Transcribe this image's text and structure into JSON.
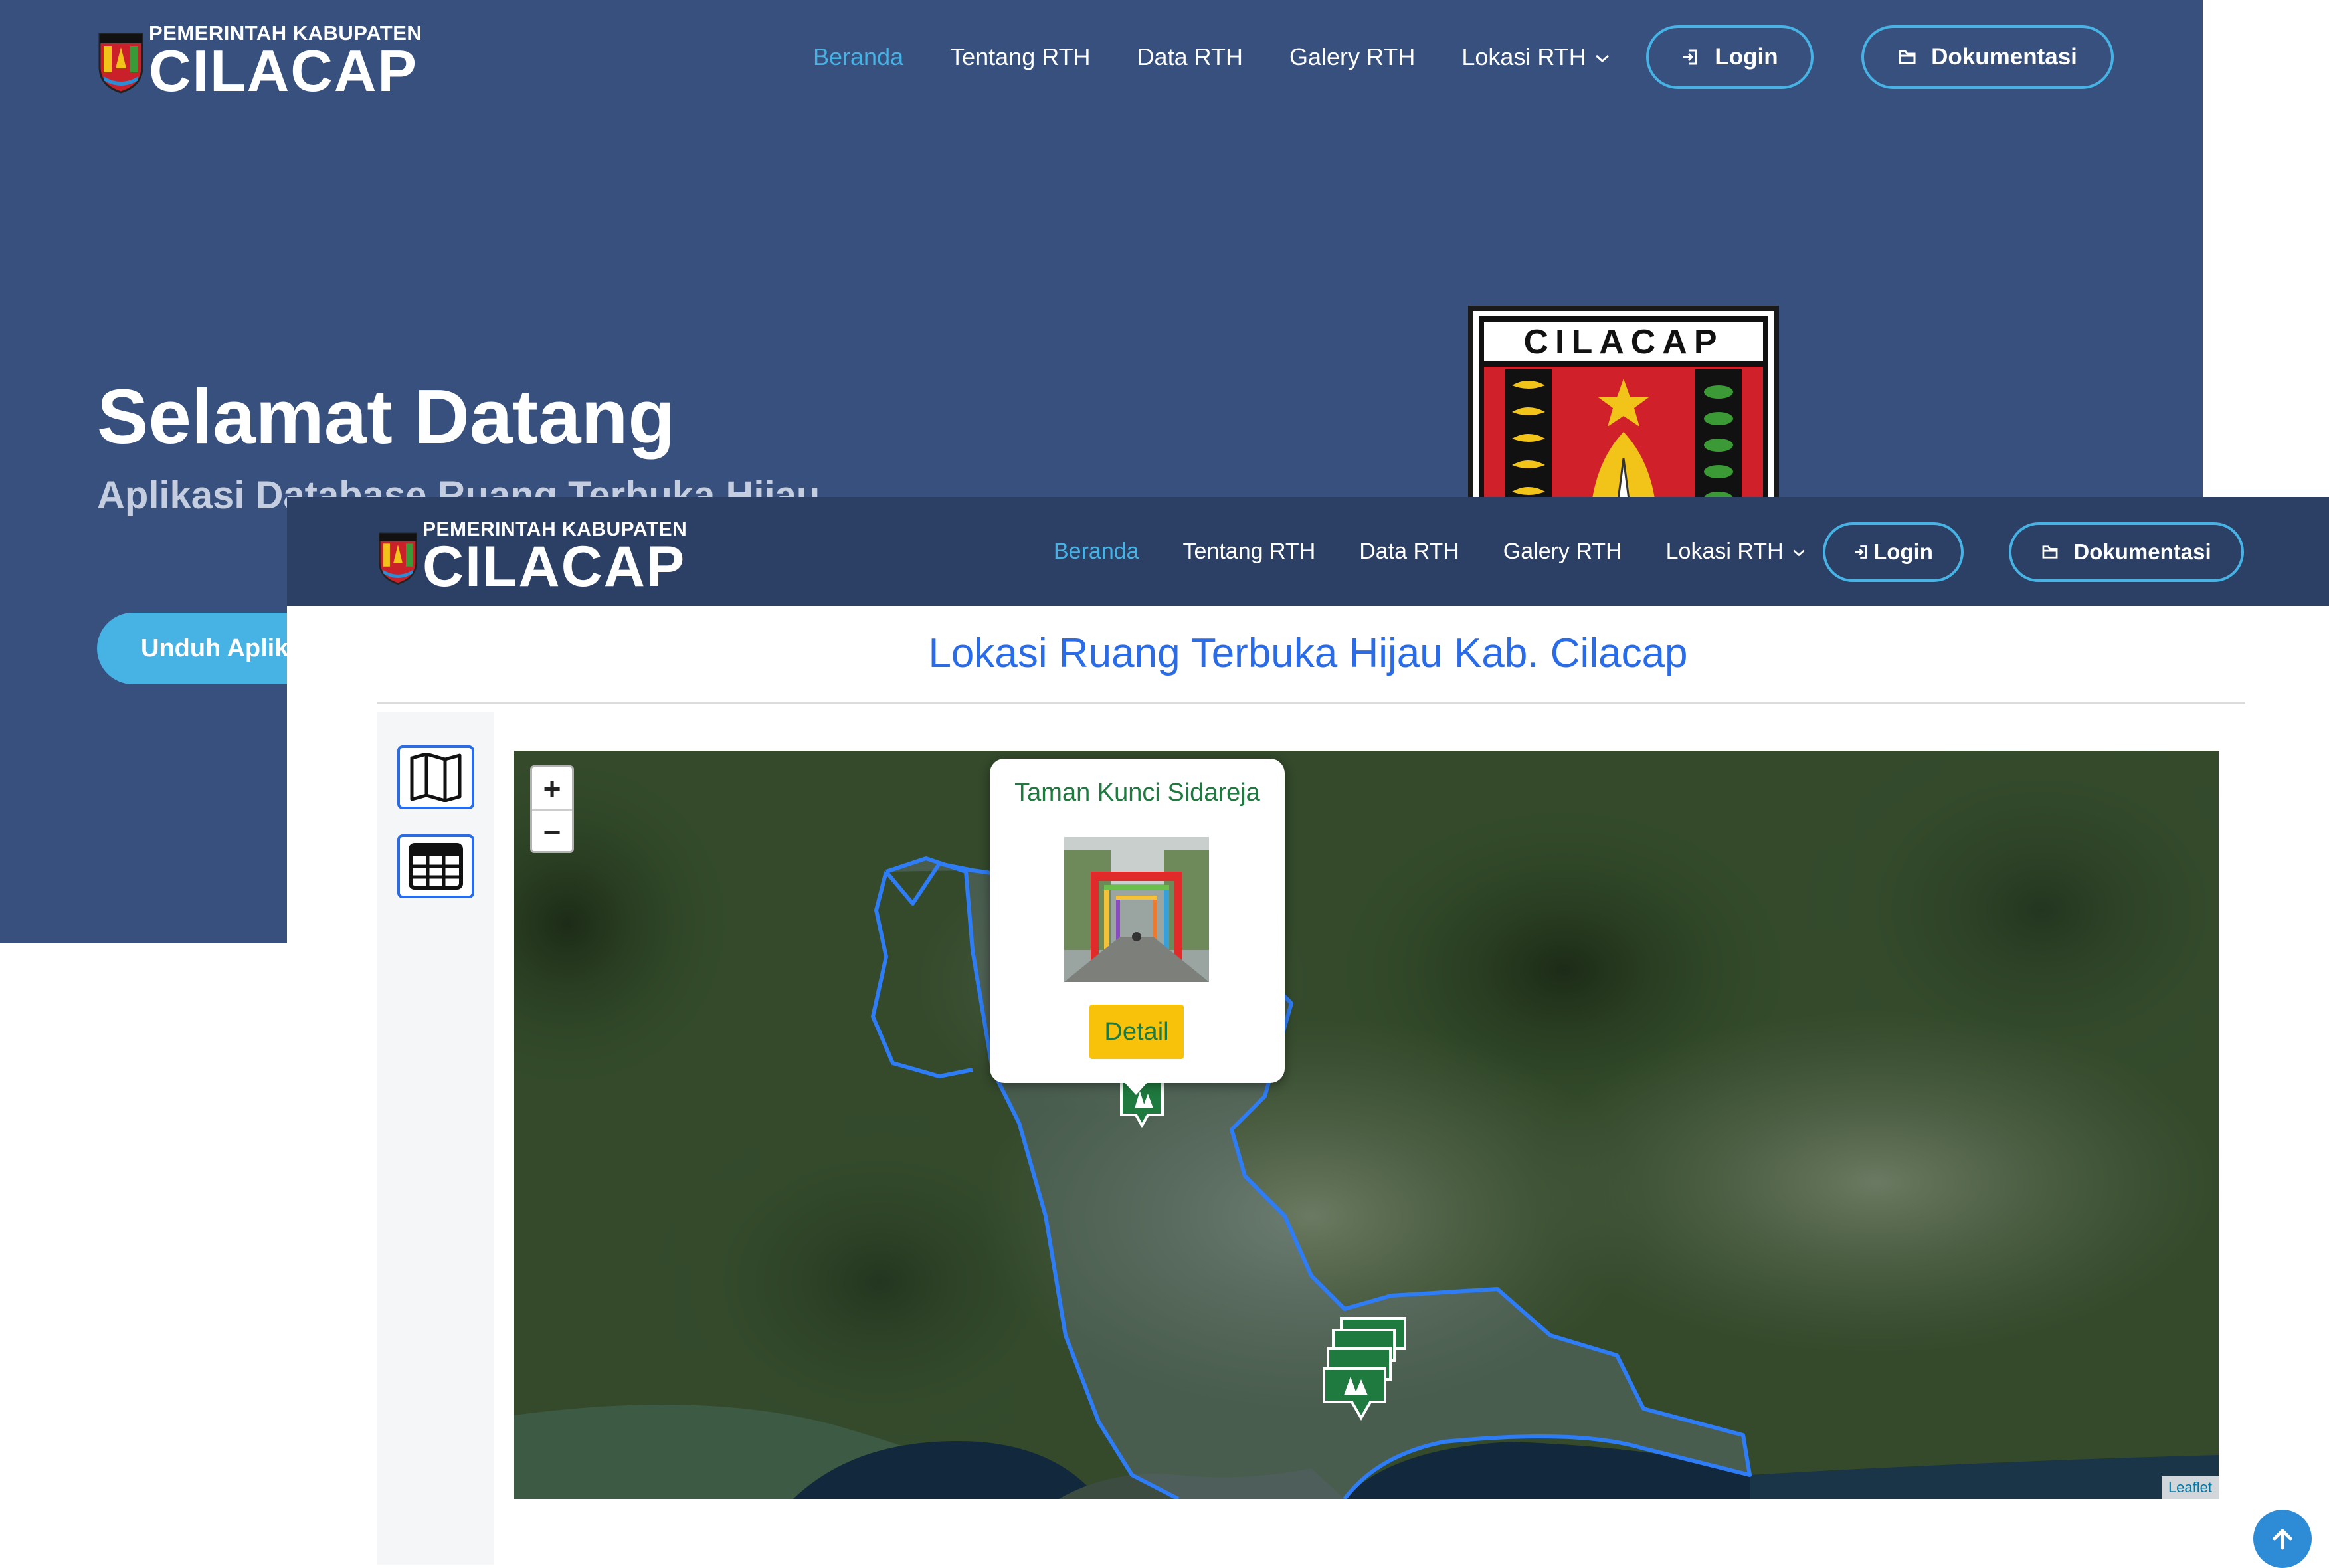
{
  "brand": {
    "line1": "PEMERINTAH KABUPATEN",
    "line2": "CILACAP",
    "crest_mini_text": "CILACAP"
  },
  "back_window": {
    "nav": [
      "Beranda",
      "Tentang RTH",
      "Data RTH",
      "Galery RTH",
      "Lokasi RTH"
    ],
    "active_nav": "Beranda",
    "login_label": "Login",
    "docs_label": "Dokumentasi",
    "hero_title": "Selamat Datang",
    "hero_subtitle": "Aplikasi Database Ruang Terbuka Hijau",
    "hero_button": "Unduh Aplikasi",
    "logo_text": "CILACAP"
  },
  "front_window": {
    "nav": [
      "Beranda",
      "Tentang RTH",
      "Data RTH",
      "Galery RTH",
      "Lokasi RTH"
    ],
    "active_nav": "Beranda",
    "login_label": "Login",
    "docs_label": "Dokumentasi",
    "page_title": "Lokasi Ruang Terbuka Hijau Kab. Cilacap",
    "sidebar": [
      {
        "icon": "map-icon"
      },
      {
        "icon": "table-icon"
      }
    ],
    "map": {
      "zoom_in_label": "+",
      "zoom_out_label": "−",
      "attribution": "Leaflet",
      "popup": {
        "title": "Taman Kunci Sidareja",
        "button": "Detail"
      }
    }
  },
  "colors": {
    "back_bg": "#38507d",
    "front_header_bg": "#2c3f65",
    "accent": "#47b2e4",
    "title_blue": "#2a6be8",
    "boundary": "#2f7df6",
    "marker_green": "#1f7a3f",
    "detail_button": "#f8c20a"
  }
}
